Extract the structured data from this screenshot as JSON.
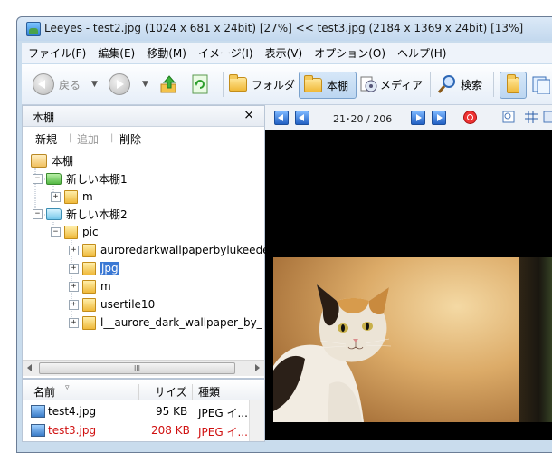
{
  "window": {
    "title": "Leeyes  -  test2.jpg (1024 x 681 x 24bit) [27%]    <<   test3.jpg (2184 x 1369 x 24bit) [13%]"
  },
  "menu": [
    "ファイル(F)",
    "編集(E)",
    "移動(M)",
    "イメージ(I)",
    "表示(V)",
    "オプション(O)",
    "ヘルプ(H)"
  ],
  "toolbar": {
    "back_label": "戻る",
    "folder_label": "フォルダ",
    "bookshelf_label": "本棚",
    "media_label": "メディア",
    "search_label": "検索",
    "icons": [
      "back-icon",
      "forward-icon",
      "up-folder-icon",
      "refresh-icon",
      "folder-icon",
      "bookshelf-icon",
      "media-icon",
      "search-icon",
      "view-mode-icon",
      "window-icon"
    ]
  },
  "pane": {
    "title": "本棚",
    "close": "×",
    "actions": {
      "new": "新規",
      "add": "追加",
      "delete": "削除"
    }
  },
  "tree": {
    "root": "本棚",
    "shelf1": "新しい本棚1",
    "shelf1_child": "m",
    "shelf2": "新しい本棚2",
    "pic": "pic",
    "items": [
      "auroredarkwallpaperbylukeede",
      "jpg",
      "m",
      "usertile10",
      "l__aurore_dark_wallpaper_by_"
    ],
    "selected": "jpg",
    "scroll_grip": "III"
  },
  "filelist": {
    "columns": {
      "name": "名前",
      "size": "サイズ",
      "type": "種類"
    },
    "rows": [
      {
        "name": "test4.jpg",
        "size": "95 KB",
        "type": "JPEG イ...",
        "color": "#000000"
      },
      {
        "name": "test3.jpg",
        "size": "208 KB",
        "type": "JPEG イ...",
        "color": "#d01010"
      }
    ]
  },
  "viewer": {
    "page_counter": "21･20 / 206"
  },
  "colors": {
    "accent": "#3a78d4",
    "highlight_red": "#d01010"
  }
}
